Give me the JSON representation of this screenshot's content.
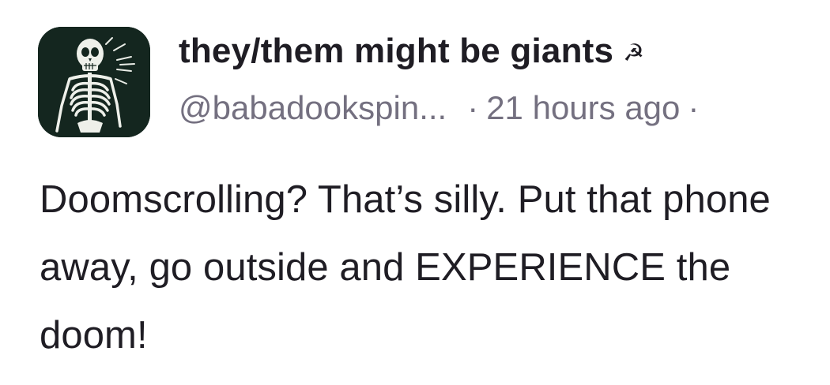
{
  "post": {
    "author": {
      "display_name": "they/them might be giants",
      "name_emoji": "☭",
      "handle": "@babadookspin...",
      "avatar_icon": "skeleton-icon"
    },
    "meta": {
      "separator": "·",
      "timestamp": "21 hours ago",
      "trailing_separator": "·"
    },
    "text": "Doomscrolling? That’s silly. Put that phone away, go outside and EXPERIENCE the doom!"
  },
  "colors": {
    "text_primary": "#1f1d24",
    "text_secondary": "#747080",
    "avatar_bg": "#14261f"
  }
}
